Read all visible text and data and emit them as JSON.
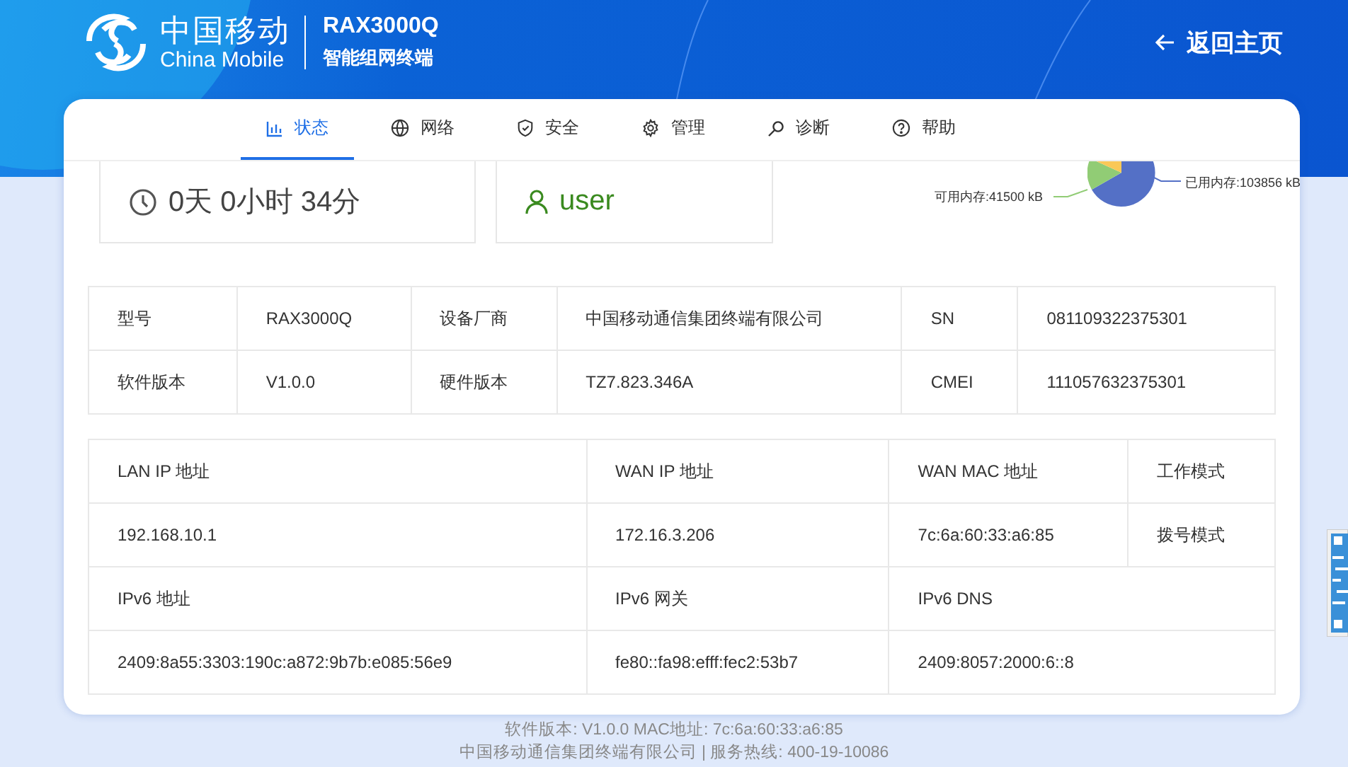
{
  "header": {
    "brand_cn": "中国移动",
    "brand_en": "China Mobile",
    "model": "RAX3000Q",
    "subtitle": "智能组网终端",
    "back_link": "返回主页"
  },
  "tabs": [
    {
      "label": "状态",
      "kind": "chart",
      "selected": true
    },
    {
      "label": "网络",
      "kind": "globe",
      "selected": false
    },
    {
      "label": "安全",
      "kind": "shield",
      "selected": false
    },
    {
      "label": "管理",
      "kind": "gear",
      "selected": false
    },
    {
      "label": "诊断",
      "kind": "search",
      "selected": false
    },
    {
      "label": "帮助",
      "kind": "help",
      "selected": false
    }
  ],
  "summary": {
    "uptime": "0天 0小时 34分",
    "account": "user",
    "memory_free": "可用内存:41500 kB",
    "memory_used": "已用内存:103856 kB"
  },
  "device_table": {
    "rows": [
      [
        "型号",
        "RAX3000Q",
        "设备厂商",
        "中国移动通信集团终端有限公司",
        "SN",
        "081109322375301"
      ],
      [
        "软件版本",
        "V1.0.0",
        "硬件版本",
        "TZ7.823.346A",
        "CMEI",
        "111057632375301"
      ]
    ]
  },
  "network_table": {
    "rows": [
      [
        "LAN IP 地址",
        "WAN IP 地址",
        "WAN MAC 地址",
        "工作模式"
      ],
      [
        "192.168.10.1",
        "172.16.3.206",
        "7c:6a:60:33:a6:85",
        "拨号模式"
      ],
      [
        "IPv6 地址",
        "IPv6 网关",
        {
          "text": "IPv6 DNS",
          "colspan": 2
        }
      ],
      [
        "2409:8a55:3303:190c:a872:9b7b:e085:56e9",
        "fe80::fa98:efff:fec2:53b7",
        {
          "text": "2409:8057:2000:6::8",
          "colspan": 2
        }
      ]
    ]
  },
  "footer": [
    "软件版本: V1.0.0 MAC地址: 7c:6a:60:33:a6:85",
    "中国移动通信集团终端有限公司 | 服务热线: 400-19-10086"
  ]
}
